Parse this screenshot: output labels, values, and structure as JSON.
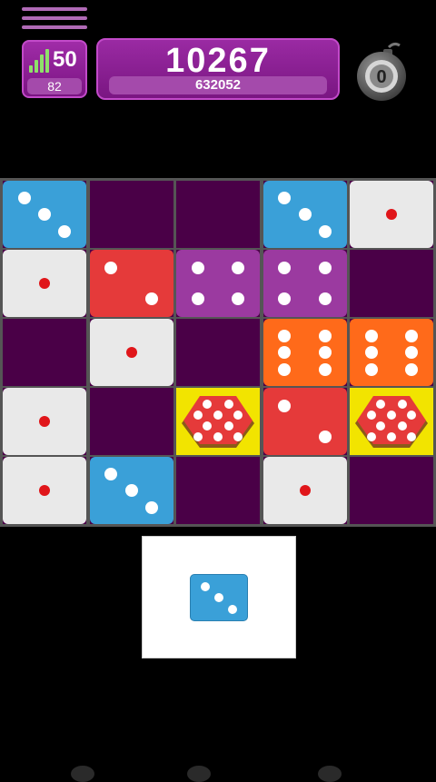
{
  "header": {
    "level": "50",
    "moves": "82",
    "score": "10267",
    "high_score": "632052",
    "bombs": "0"
  },
  "colors": {
    "empty": "#4a0047",
    "blue": "#3aa0d8",
    "white": "#e9e9e9",
    "red": "#e53a3a",
    "purple": "#9b3aa0",
    "orange": "#ff6a1a",
    "yellow": "#f2e400"
  },
  "board": {
    "rows": [
      [
        {
          "color": "blue",
          "pips": 3
        },
        {
          "color": "empty",
          "pips": 0
        },
        {
          "color": "empty",
          "pips": 0
        },
        {
          "color": "blue",
          "pips": 3
        },
        {
          "color": "white",
          "pips": 1
        }
      ],
      [
        {
          "color": "white",
          "pips": 1
        },
        {
          "color": "red",
          "pips": 2
        },
        {
          "color": "purple",
          "pips": 4
        },
        {
          "color": "purple",
          "pips": 4
        },
        {
          "color": "empty",
          "pips": 0
        }
      ],
      [
        {
          "color": "empty",
          "pips": 0
        },
        {
          "color": "white",
          "pips": 1
        },
        {
          "color": "empty",
          "pips": 0
        },
        {
          "color": "orange",
          "pips": 6
        },
        {
          "color": "orange",
          "pips": 6
        }
      ],
      [
        {
          "color": "white",
          "pips": 1
        },
        {
          "color": "empty",
          "pips": 0
        },
        {
          "color": "special",
          "pips": 0
        },
        {
          "color": "red",
          "pips": 2
        },
        {
          "color": "special",
          "pips": 0
        }
      ],
      [
        {
          "color": "white",
          "pips": 1
        },
        {
          "color": "blue",
          "pips": 3
        },
        {
          "color": "empty",
          "pips": 0
        },
        {
          "color": "white",
          "pips": 1
        },
        {
          "color": "empty",
          "pips": 0
        }
      ]
    ]
  },
  "next_piece": {
    "color": "blue",
    "pips": 3
  }
}
